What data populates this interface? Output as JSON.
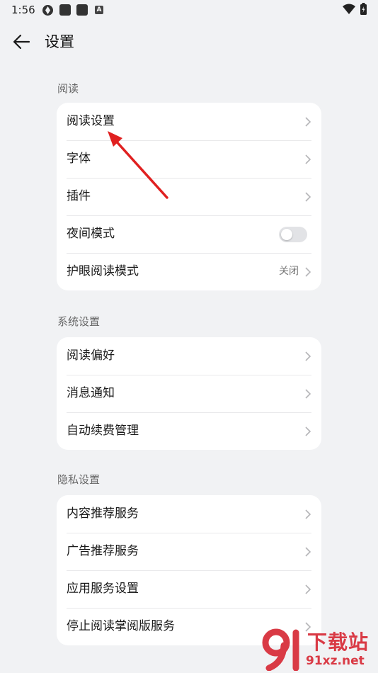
{
  "status_bar": {
    "time": "1:56"
  },
  "header": {
    "title": "设置"
  },
  "sections": [
    {
      "label": "阅读",
      "items": [
        {
          "label": "阅读设置"
        },
        {
          "label": "字体"
        },
        {
          "label": "插件"
        },
        {
          "label": "夜间模式",
          "toggle_on": false
        },
        {
          "label": "护眼阅读模式",
          "value": "关闭"
        }
      ]
    },
    {
      "label": "系统设置",
      "items": [
        {
          "label": "阅读偏好"
        },
        {
          "label": "消息通知"
        },
        {
          "label": "自动续费管理"
        }
      ]
    },
    {
      "label": "隐私设置",
      "items": [
        {
          "label": "内容推荐服务"
        },
        {
          "label": "广告推荐服务"
        },
        {
          "label": "应用服务设置"
        },
        {
          "label": "停止阅读掌阅版服务"
        }
      ]
    }
  ],
  "watermark": {
    "title": "下载站",
    "url": "91xz.net"
  },
  "colors": {
    "background": "#f1f2f4",
    "card": "#ffffff",
    "annotation_arrow": "#e02020",
    "watermark": "#d93a45"
  }
}
